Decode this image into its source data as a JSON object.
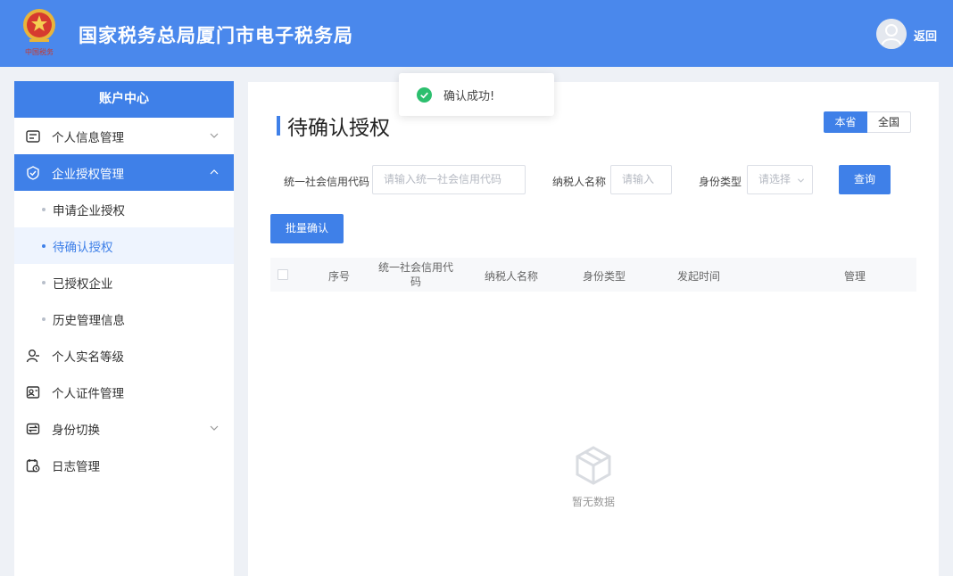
{
  "header": {
    "logo_text": "中国税务",
    "title": "国家税务总局厦门市电子税务局",
    "back_label": "返回"
  },
  "sidebar": {
    "heading": "账户中心",
    "items": [
      {
        "label": "个人信息管理",
        "icon": "id-card-icon",
        "expandable": true
      },
      {
        "label": "企业授权管理",
        "icon": "shield-check-icon",
        "expandable": true,
        "expanded": true
      },
      {
        "label": "个人实名等级",
        "icon": "user-level-icon"
      },
      {
        "label": "个人证件管理",
        "icon": "certificate-icon"
      },
      {
        "label": "身份切换",
        "icon": "switch-icon",
        "expandable": true
      },
      {
        "label": "日志管理",
        "icon": "log-calendar-icon"
      }
    ],
    "subitems": [
      {
        "label": "申请企业授权"
      },
      {
        "label": "待确认授权",
        "current": true
      },
      {
        "label": "已授权企业"
      },
      {
        "label": "历史管理信息"
      }
    ]
  },
  "main": {
    "title": "待确认授权",
    "scope_tabs": [
      "本省",
      "全国"
    ],
    "filters": {
      "credit_code_label": "统一社会信用代码",
      "credit_code_placeholder": "请输入统一社会信用代码",
      "taxpayer_label": "纳税人名称",
      "taxpayer_placeholder": "请输入",
      "identity_label": "身份类型",
      "identity_placeholder": "请选择",
      "query_button": "查询"
    },
    "batch_button": "批量确认",
    "table": {
      "columns": [
        "序号",
        "统一社会信用代码",
        "纳税人名称",
        "身份类型",
        "发起时间",
        "管理"
      ],
      "rows": []
    },
    "empty_text": "暂无数据"
  },
  "toast": {
    "message": "确认成功!"
  },
  "colors": {
    "header": "#4a88ec",
    "accent": "#3f80e8",
    "success": "#2cbf6e"
  }
}
